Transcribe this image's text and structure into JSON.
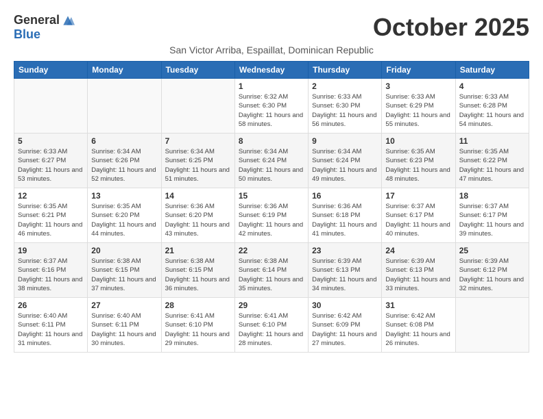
{
  "logo": {
    "line1": "General",
    "line2": "Blue"
  },
  "title": "October 2025",
  "subtitle": "San Victor Arriba, Espaillat, Dominican Republic",
  "weekdays": [
    "Sunday",
    "Monday",
    "Tuesday",
    "Wednesday",
    "Thursday",
    "Friday",
    "Saturday"
  ],
  "weeks": [
    [
      {
        "day": "",
        "info": ""
      },
      {
        "day": "",
        "info": ""
      },
      {
        "day": "",
        "info": ""
      },
      {
        "day": "1",
        "info": "Sunrise: 6:32 AM\nSunset: 6:30 PM\nDaylight: 11 hours and 58 minutes."
      },
      {
        "day": "2",
        "info": "Sunrise: 6:33 AM\nSunset: 6:30 PM\nDaylight: 11 hours and 56 minutes."
      },
      {
        "day": "3",
        "info": "Sunrise: 6:33 AM\nSunset: 6:29 PM\nDaylight: 11 hours and 55 minutes."
      },
      {
        "day": "4",
        "info": "Sunrise: 6:33 AM\nSunset: 6:28 PM\nDaylight: 11 hours and 54 minutes."
      }
    ],
    [
      {
        "day": "5",
        "info": "Sunrise: 6:33 AM\nSunset: 6:27 PM\nDaylight: 11 hours and 53 minutes."
      },
      {
        "day": "6",
        "info": "Sunrise: 6:34 AM\nSunset: 6:26 PM\nDaylight: 11 hours and 52 minutes."
      },
      {
        "day": "7",
        "info": "Sunrise: 6:34 AM\nSunset: 6:25 PM\nDaylight: 11 hours and 51 minutes."
      },
      {
        "day": "8",
        "info": "Sunrise: 6:34 AM\nSunset: 6:24 PM\nDaylight: 11 hours and 50 minutes."
      },
      {
        "day": "9",
        "info": "Sunrise: 6:34 AM\nSunset: 6:24 PM\nDaylight: 11 hours and 49 minutes."
      },
      {
        "day": "10",
        "info": "Sunrise: 6:35 AM\nSunset: 6:23 PM\nDaylight: 11 hours and 48 minutes."
      },
      {
        "day": "11",
        "info": "Sunrise: 6:35 AM\nSunset: 6:22 PM\nDaylight: 11 hours and 47 minutes."
      }
    ],
    [
      {
        "day": "12",
        "info": "Sunrise: 6:35 AM\nSunset: 6:21 PM\nDaylight: 11 hours and 46 minutes."
      },
      {
        "day": "13",
        "info": "Sunrise: 6:35 AM\nSunset: 6:20 PM\nDaylight: 11 hours and 44 minutes."
      },
      {
        "day": "14",
        "info": "Sunrise: 6:36 AM\nSunset: 6:20 PM\nDaylight: 11 hours and 43 minutes."
      },
      {
        "day": "15",
        "info": "Sunrise: 6:36 AM\nSunset: 6:19 PM\nDaylight: 11 hours and 42 minutes."
      },
      {
        "day": "16",
        "info": "Sunrise: 6:36 AM\nSunset: 6:18 PM\nDaylight: 11 hours and 41 minutes."
      },
      {
        "day": "17",
        "info": "Sunrise: 6:37 AM\nSunset: 6:17 PM\nDaylight: 11 hours and 40 minutes."
      },
      {
        "day": "18",
        "info": "Sunrise: 6:37 AM\nSunset: 6:17 PM\nDaylight: 11 hours and 39 minutes."
      }
    ],
    [
      {
        "day": "19",
        "info": "Sunrise: 6:37 AM\nSunset: 6:16 PM\nDaylight: 11 hours and 38 minutes."
      },
      {
        "day": "20",
        "info": "Sunrise: 6:38 AM\nSunset: 6:15 PM\nDaylight: 11 hours and 37 minutes."
      },
      {
        "day": "21",
        "info": "Sunrise: 6:38 AM\nSunset: 6:15 PM\nDaylight: 11 hours and 36 minutes."
      },
      {
        "day": "22",
        "info": "Sunrise: 6:38 AM\nSunset: 6:14 PM\nDaylight: 11 hours and 35 minutes."
      },
      {
        "day": "23",
        "info": "Sunrise: 6:39 AM\nSunset: 6:13 PM\nDaylight: 11 hours and 34 minutes."
      },
      {
        "day": "24",
        "info": "Sunrise: 6:39 AM\nSunset: 6:13 PM\nDaylight: 11 hours and 33 minutes."
      },
      {
        "day": "25",
        "info": "Sunrise: 6:39 AM\nSunset: 6:12 PM\nDaylight: 11 hours and 32 minutes."
      }
    ],
    [
      {
        "day": "26",
        "info": "Sunrise: 6:40 AM\nSunset: 6:11 PM\nDaylight: 11 hours and 31 minutes."
      },
      {
        "day": "27",
        "info": "Sunrise: 6:40 AM\nSunset: 6:11 PM\nDaylight: 11 hours and 30 minutes."
      },
      {
        "day": "28",
        "info": "Sunrise: 6:41 AM\nSunset: 6:10 PM\nDaylight: 11 hours and 29 minutes."
      },
      {
        "day": "29",
        "info": "Sunrise: 6:41 AM\nSunset: 6:10 PM\nDaylight: 11 hours and 28 minutes."
      },
      {
        "day": "30",
        "info": "Sunrise: 6:42 AM\nSunset: 6:09 PM\nDaylight: 11 hours and 27 minutes."
      },
      {
        "day": "31",
        "info": "Sunrise: 6:42 AM\nSunset: 6:08 PM\nDaylight: 11 hours and 26 minutes."
      },
      {
        "day": "",
        "info": ""
      }
    ]
  ]
}
